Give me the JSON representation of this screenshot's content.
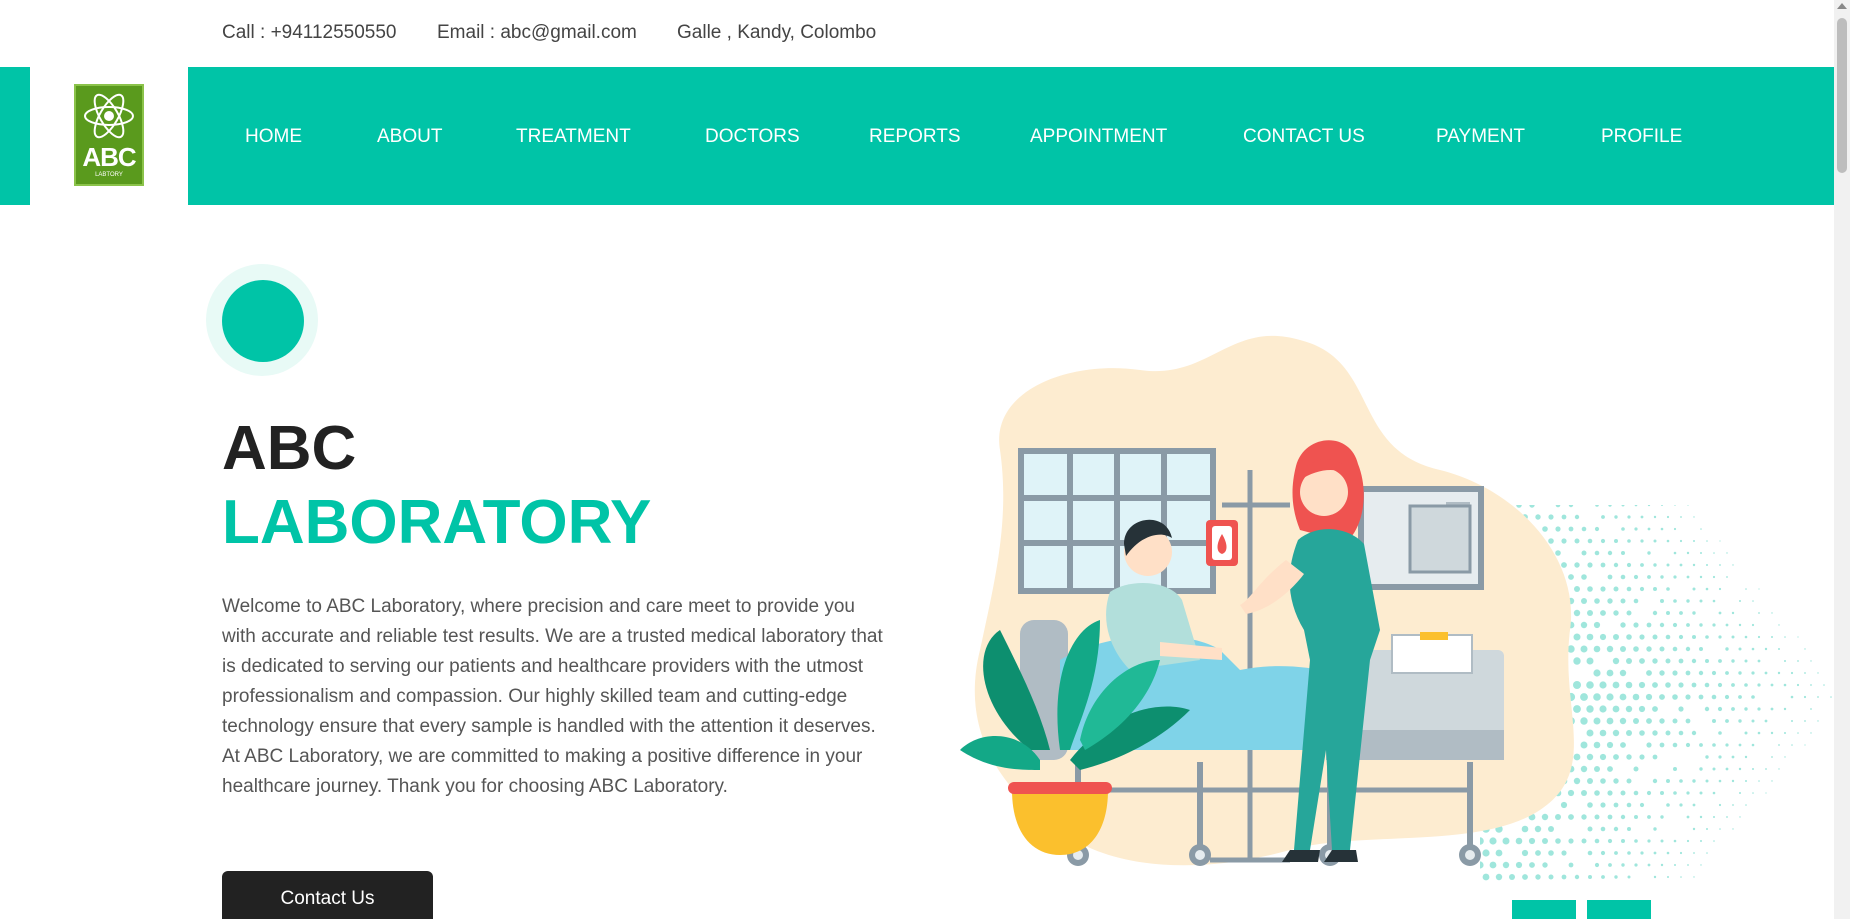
{
  "topbar": {
    "call": "Call : +94112550550",
    "email": "Email : abc@gmail.com",
    "locations": "Galle ,   Kandy,   Colombo"
  },
  "logo": {
    "text": "ABC",
    "subtext": "LABTORY"
  },
  "nav": {
    "items": [
      {
        "label": "HOME"
      },
      {
        "label": "ABOUT"
      },
      {
        "label": "TREATMENT"
      },
      {
        "label": "DOCTORS"
      },
      {
        "label": "REPORTS"
      },
      {
        "label": "APPOINTMENT"
      },
      {
        "label": "CONTACT US"
      },
      {
        "label": "PAYMENT"
      },
      {
        "label": "PROFILE"
      }
    ]
  },
  "hero": {
    "title_line1": "ABC",
    "title_line2": "LABORATORY",
    "description": "Welcome to ABC Laboratory, where precision and care meet to provide you with accurate and reliable test results. We are a trusted medical laboratory that is dedicated to serving our patients and healthcare providers with the utmost professionalism and compassion. Our highly skilled team and cutting-edge technology ensure that every sample is handled with the attention it deserves. At ABC Laboratory, we are committed to making a positive difference in your healthcare journey. Thank you for choosing ABC Laboratory.",
    "cta_label": "Contact Us",
    "illustration": "hospital-patient-nurse-illustration"
  },
  "colors": {
    "accent": "#00c4a7",
    "dark": "#222222",
    "text": "#555555",
    "logo_green": "#5a9a1d"
  }
}
